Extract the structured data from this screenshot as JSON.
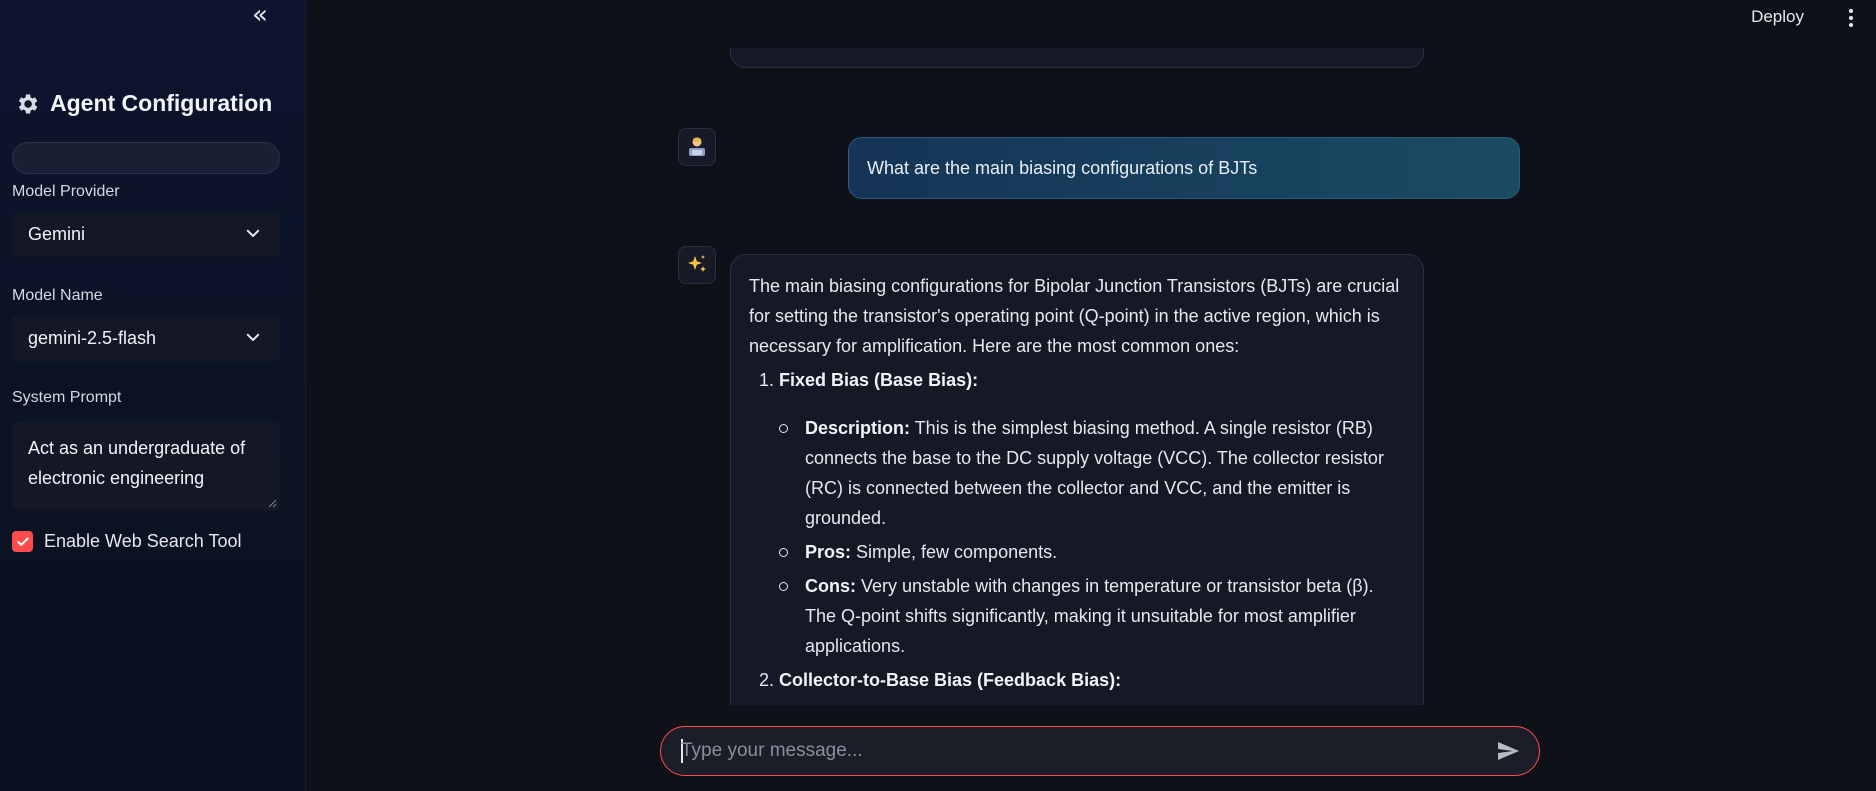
{
  "sidebar": {
    "collapse_icon": "chevrons-left-icon",
    "title": "Agent Configuration",
    "title_icon": "gear-icon",
    "model_provider": {
      "label": "Model Provider",
      "value": "Gemini"
    },
    "model_name": {
      "label": "Model Name",
      "value": "gemini-2.5-flash"
    },
    "system_prompt": {
      "label": "System Prompt",
      "value": "Act as an undergraduate of electronic engineering"
    },
    "web_search": {
      "label": "Enable Web Search Tool",
      "checked": true
    }
  },
  "topbar": {
    "deploy_label": "Deploy",
    "menu_icon": "kebab-menu-icon"
  },
  "messages": {
    "user": {
      "text": "What are the main biasing configurations of BJTs",
      "avatar": "user-avatar-icon"
    },
    "assistant": {
      "avatar": "sparkles-icon",
      "intro": "The main biasing configurations for Bipolar Junction Transistors (BJTs) are crucial for setting the transistor's operating point (Q-point) in the active region, which is necessary for amplification. Here are the most common ones:",
      "items": [
        {
          "title": "Fixed Bias (Base Bias):",
          "bullets": [
            {
              "label": "Description:",
              "text": " This is the simplest biasing method. A single resistor (RB) connects the base to the DC supply voltage (VCC). The collector resistor (RC) is connected between the collector and VCC, and the emitter is grounded."
            },
            {
              "label": "Pros:",
              "text": " Simple, few components."
            },
            {
              "label": "Cons:",
              "text": " Very unstable with changes in temperature or transistor beta (β). The Q-point shifts significantly, making it unsuitable for most amplifier applications."
            }
          ]
        },
        {
          "title": "Collector-to-Base Bias (Feedback Bias):"
        }
      ]
    }
  },
  "input": {
    "placeholder": "Type your message...",
    "send_icon": "send-icon"
  },
  "colors": {
    "accent": "#ff4b4b",
    "user_bubble": "#17425e",
    "background": "#0f1118",
    "sidebar": "#0d1530"
  }
}
